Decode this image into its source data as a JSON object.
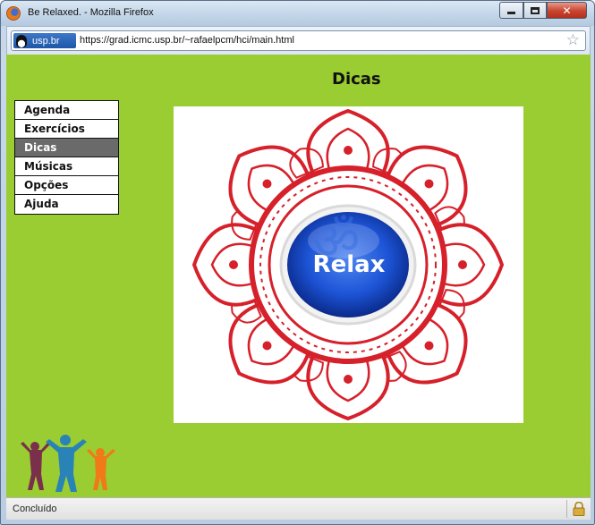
{
  "window": {
    "title": "Be Relaxed. - Mozilla Firefox",
    "close_label": "✕"
  },
  "navbar": {
    "site_identity": "usp.br",
    "url": "https://grad.icmc.usp.br/~rafaelpcm/hci/main.html",
    "bookmark_star": "☆"
  },
  "page": {
    "title": "Dicas",
    "image_text": "Relax"
  },
  "menu": {
    "items": [
      {
        "label": "Agenda"
      },
      {
        "label": "Exercícios"
      },
      {
        "label": "Dicas"
      },
      {
        "label": "Músicas"
      },
      {
        "label": "Opções"
      },
      {
        "label": "Ajuda"
      }
    ],
    "active": "Dicas"
  },
  "colors": {
    "page_background": "#9acd32",
    "active_menu": "#6a6a6a",
    "mandala_red": "#d6202a",
    "relax_blue": "#1d54d6"
  },
  "status": {
    "text": "Concluído"
  }
}
